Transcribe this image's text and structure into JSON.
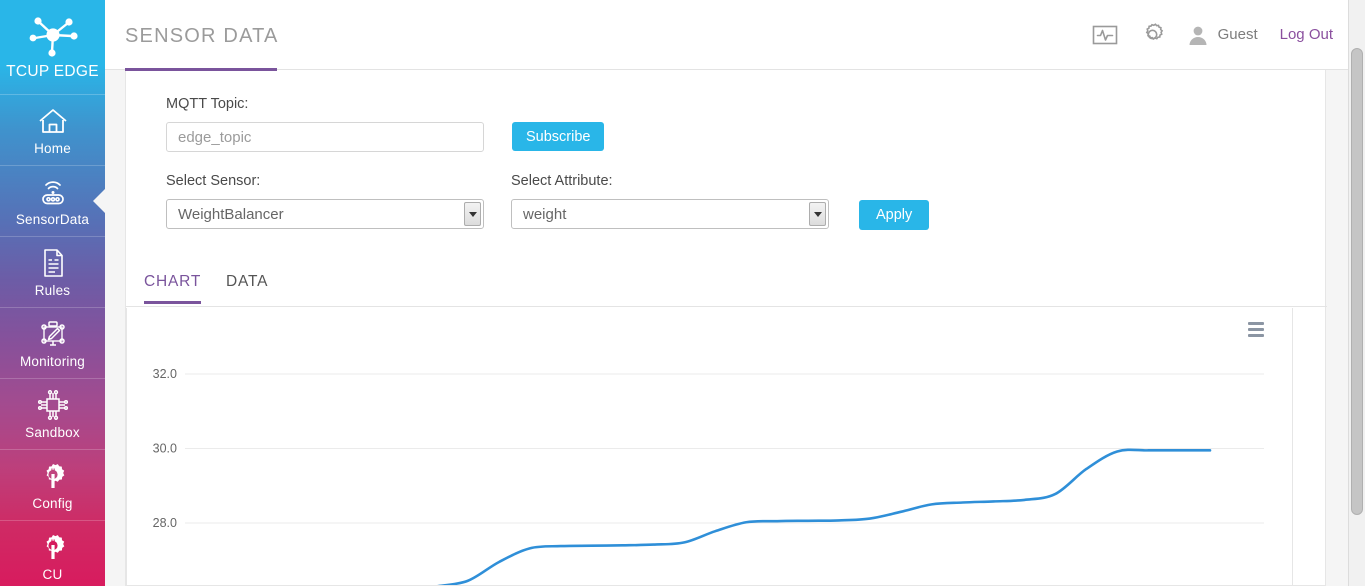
{
  "sidebar": {
    "brand": {
      "name": "TCUP EDGE",
      "logo_icon": "network-nodes-icon"
    },
    "items": [
      {
        "label": "Home",
        "icon": "home-icon",
        "active": false
      },
      {
        "label": "SensorData",
        "icon": "sensor-wifi-icon",
        "active": true
      },
      {
        "label": "Rules",
        "icon": "document-icon",
        "active": false
      },
      {
        "label": "Monitoring",
        "icon": "monitor-pen-icon",
        "active": false
      },
      {
        "label": "Sandbox",
        "icon": "chip-icon",
        "active": false
      },
      {
        "label": "Config",
        "icon": "gear-wrench-icon",
        "active": false
      },
      {
        "label": "CU",
        "icon": "gear-wrench-icon",
        "active": false
      }
    ]
  },
  "header": {
    "title": "SENSOR DATA",
    "monitor_icon": "activity-monitor-icon",
    "settings_icon": "gear-icon",
    "avatar_icon": "user-avatar-icon",
    "user_name": "Guest",
    "logout_label": "Log Out"
  },
  "form": {
    "mqtt_label": "MQTT Topic:",
    "mqtt_value": "",
    "mqtt_placeholder": "edge_topic",
    "subscribe_label": "Subscribe",
    "sensor_label": "Select Sensor:",
    "sensor_value": "WeightBalancer",
    "attribute_label": "Select Attribute:",
    "attribute_value": "weight",
    "apply_label": "Apply"
  },
  "tabs": [
    {
      "label": "CHART",
      "active": true
    },
    {
      "label": "DATA",
      "active": false
    }
  ],
  "chart_panel": {
    "export_menu_icon": "hamburger-menu-icon"
  },
  "colors": {
    "accent_blue": "#29b6e8",
    "accent_purple": "#7a549c",
    "series_blue": "#2f8fd8",
    "gridline": "#ebebeb",
    "tick_text": "#666666"
  },
  "chart_data": {
    "type": "line",
    "title": "",
    "xlabel": "",
    "ylabel": "",
    "grid": true,
    "legend": false,
    "ylim": [
      26.2,
      32.8
    ],
    "yticks": [
      28.0,
      30.0,
      32.0
    ],
    "ytick_labels": [
      "28.0",
      "30.0",
      "32.0"
    ],
    "series": [
      {
        "name": "weight",
        "color": "#2f8fd8",
        "points": [
          {
            "x": 0,
            "y": 26.3
          },
          {
            "x": 1,
            "y": 26.45
          },
          {
            "x": 2,
            "y": 26.95
          },
          {
            "x": 3,
            "y": 27.32
          },
          {
            "x": 4,
            "y": 27.38
          },
          {
            "x": 5,
            "y": 27.39
          },
          {
            "x": 6,
            "y": 27.4
          },
          {
            "x": 7,
            "y": 27.42
          },
          {
            "x": 8,
            "y": 27.48
          },
          {
            "x": 9,
            "y": 27.78
          },
          {
            "x": 10,
            "y": 28.02
          },
          {
            "x": 11,
            "y": 28.05
          },
          {
            "x": 12,
            "y": 28.06
          },
          {
            "x": 13,
            "y": 28.07
          },
          {
            "x": 14,
            "y": 28.12
          },
          {
            "x": 15,
            "y": 28.3
          },
          {
            "x": 16,
            "y": 28.5
          },
          {
            "x": 17,
            "y": 28.55
          },
          {
            "x": 18,
            "y": 28.58
          },
          {
            "x": 19,
            "y": 28.62
          },
          {
            "x": 20,
            "y": 28.78
          },
          {
            "x": 21,
            "y": 29.45
          },
          {
            "x": 22,
            "y": 29.92
          },
          {
            "x": 23,
            "y": 29.95
          },
          {
            "x": 24,
            "y": 29.95
          },
          {
            "x": 25,
            "y": 29.95
          }
        ]
      }
    ]
  }
}
